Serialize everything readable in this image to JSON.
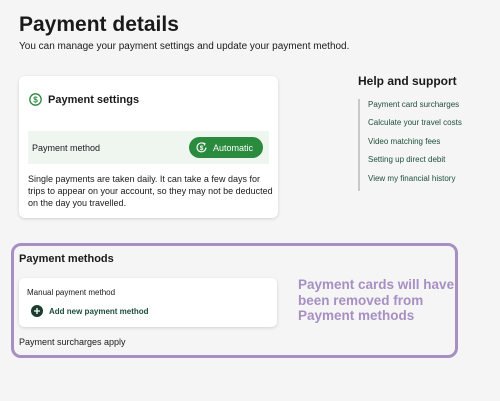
{
  "header": {
    "title": "Payment details",
    "subtitle": "You can manage your payment settings and update your payment method."
  },
  "settings": {
    "title": "Payment settings",
    "icon": "dollar-circle-icon",
    "method_label": "Payment method",
    "method_value": "Automatic",
    "description": "Single payments are taken daily. It can take a few days for trips to appear on your account, so they may not be deducted on the day you travelled."
  },
  "help": {
    "title": "Help and support",
    "links": [
      "Payment card surcharges",
      "Calculate your travel costs",
      "Video matching fees",
      "Setting up direct debit",
      "View my financial history"
    ]
  },
  "methods": {
    "title": "Payment methods",
    "manual_label": "Manual payment method",
    "add_label": "Add new payment method",
    "add_icon": "plus-circle-icon",
    "surcharge_note": "Payment surcharges apply"
  },
  "annotation": {
    "text": "Payment cards will have been removed from Payment methods"
  },
  "colors": {
    "accent_green": "#2a8a3e",
    "link_green": "#1c4f3a",
    "highlight_purple": "#a78fc4",
    "row_tint": "#eef6ef"
  }
}
